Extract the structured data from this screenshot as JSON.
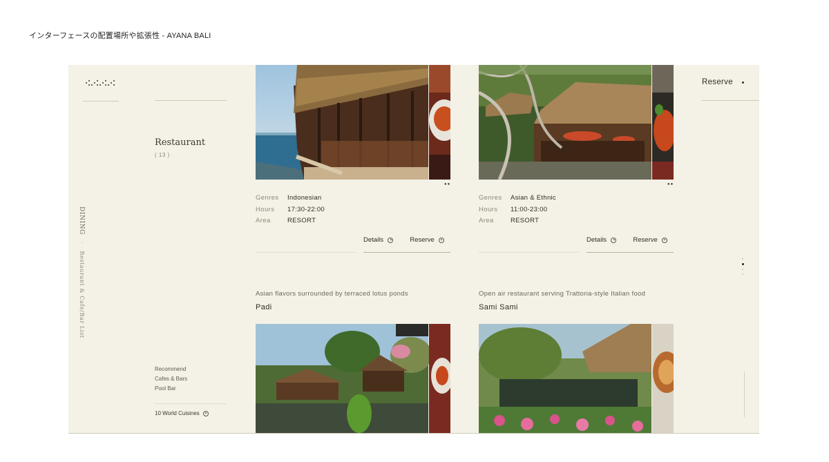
{
  "caption": "インターフェースの配置場所や拡張性 - AYANA BALI",
  "sidebar": {
    "category_title": "Restaurant",
    "category_count": "( 13 )",
    "vertical_primary": "DINING",
    "vertical_separator": "·",
    "vertical_secondary": "Restaurant & Cafe/Bar List",
    "filters": [
      "Recommend",
      "Cafes & Bars",
      "Pool Bar"
    ],
    "world_link": "10 World Cuisines"
  },
  "header": {
    "reserve_label": "Reserve"
  },
  "labels": {
    "genres": "Genres",
    "hours": "Hours",
    "area": "Area",
    "details": "Details",
    "reserve": "Reserve"
  },
  "cards": [
    {
      "genres": "Indonesian",
      "hours": "17:30-22:00",
      "area": "RESORT"
    },
    {
      "genres": "Asian & Ethnic",
      "hours": "11:00-23:00",
      "area": "RESORT"
    }
  ],
  "next_cards": [
    {
      "tagline": "Asian flavors surrounded by terraced lotus ponds",
      "name": "Padi"
    },
    {
      "tagline": "Open air restaurant serving Trattoria-style Italian food",
      "name": "Sami Sami"
    }
  ],
  "colors": {
    "background": "#f4f1e7",
    "text": "#2f2c27",
    "muted": "#8d887a"
  }
}
